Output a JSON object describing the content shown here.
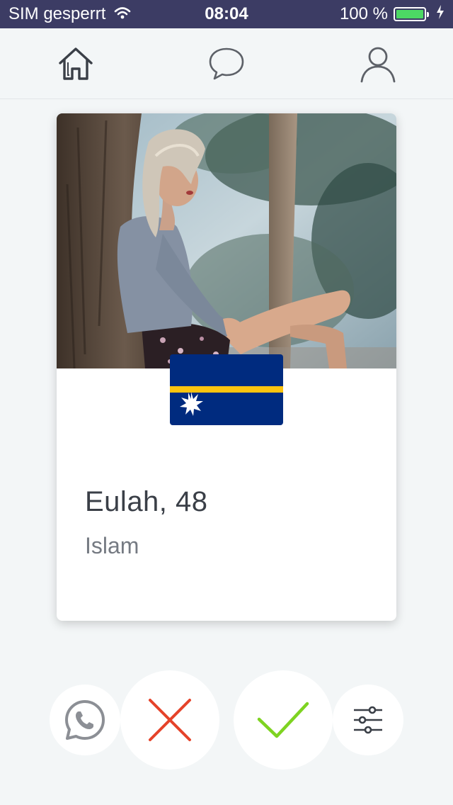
{
  "status_bar": {
    "carrier": "SIM gesperrt",
    "time": "08:04",
    "battery_text": "100 %",
    "battery_level": 1.0
  },
  "nav": {
    "items": [
      {
        "name": "home",
        "icon": "home-icon"
      },
      {
        "name": "chat",
        "icon": "chat-bubble-icon"
      },
      {
        "name": "profile",
        "icon": "user-icon"
      }
    ]
  },
  "profile": {
    "name_age": "Eulah, 48",
    "religion": "Islam",
    "flag": "nauru-flag"
  },
  "actions": {
    "whatsapp_icon": "whatsapp-icon",
    "dislike_icon": "x-icon",
    "like_icon": "check-icon",
    "filter_icon": "sliders-icon"
  },
  "colors": {
    "status_bar": "#3c3c64",
    "dislike": "#e5432a",
    "like": "#7ed321",
    "flag_blue": "#002b7f",
    "flag_yellow": "#fcc40f"
  }
}
